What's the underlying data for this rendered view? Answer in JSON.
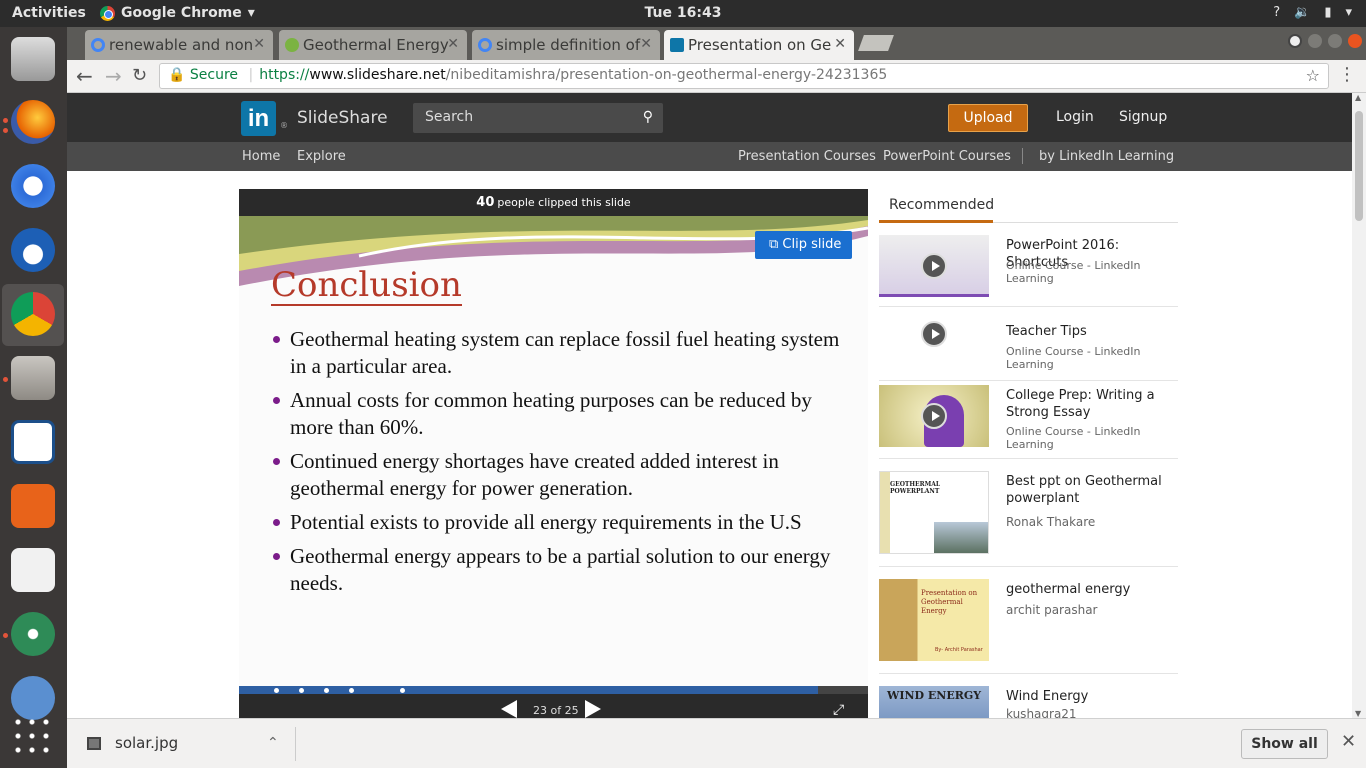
{
  "system": {
    "activities": "Activities",
    "app_name": "Google Chrome",
    "clock": "Tue 16:43"
  },
  "tabs": [
    {
      "label": "renewable and non",
      "active": false
    },
    {
      "label": "Geothermal Energy",
      "active": false
    },
    {
      "label": "simple definition of",
      "active": false
    },
    {
      "label": "Presentation on Ge",
      "active": true
    }
  ],
  "address": {
    "secure": "Secure",
    "scheme": "https://",
    "host": "www.slideshare.net",
    "path": "/nibeditamishra/presentation-on-geothermal-energy-24231365"
  },
  "header": {
    "logo": "in",
    "brand": "SlideShare",
    "search_placeholder": "Search",
    "upload": "Upload",
    "login": "Login",
    "signup": "Signup"
  },
  "subnav": {
    "home": "Home",
    "explore": "Explore",
    "presentation_courses": "Presentation Courses",
    "powerpoint_courses": "PowerPoint Courses",
    "linkedin_learning": "by LinkedIn Learning"
  },
  "player": {
    "clip_count": "40",
    "clip_text": "people clipped this slide",
    "clip_button": "Clip slide",
    "slide_title": "Conclusion",
    "bullets": [
      "Geothermal heating system can replace fossil fuel heating system in a particular area.",
      "Annual costs for common heating purposes can be reduced by more than 60%.",
      "Continued energy shortages have created added interest in geothermal energy for power generation.",
      "Potential exists to provide all energy requirements in the U.S",
      "Geothermal energy appears to be a partial solution to our energy needs."
    ],
    "page_indicator": "23 of 25",
    "progress_fraction": 0.92
  },
  "recommended": {
    "heading": "Recommended",
    "items": [
      {
        "title": "PowerPoint 2016: Shortcuts",
        "subtitle": "Online Course - LinkedIn Learning"
      },
      {
        "title": "Teacher Tips",
        "subtitle": "Online Course - LinkedIn Learning"
      },
      {
        "title": "College Prep: Writing a Strong Essay",
        "subtitle": "Online Course - LinkedIn Learning"
      },
      {
        "title": "Best ppt on Geothermal powerplant",
        "subtitle": "Ronak Thakare",
        "thumb_text": "GEOTHERMAL POWERPLANT"
      },
      {
        "title": "geothermal energy",
        "subtitle": "archit parashar",
        "thumb_text": "Presentation on Geothermal Energy",
        "thumb_by": "By- Archit Parashar"
      },
      {
        "title": "Wind Energy",
        "subtitle": "kushagra21",
        "thumb_text": "WIND ENERGY"
      }
    ]
  },
  "downloads": {
    "file": "solar.jpg",
    "show_all": "Show all"
  },
  "colors": {
    "brand_blue": "#0e76a8",
    "upload_orange": "#c56a11",
    "clip_blue": "#1a6fd0",
    "title_red": "#b53a2a"
  }
}
